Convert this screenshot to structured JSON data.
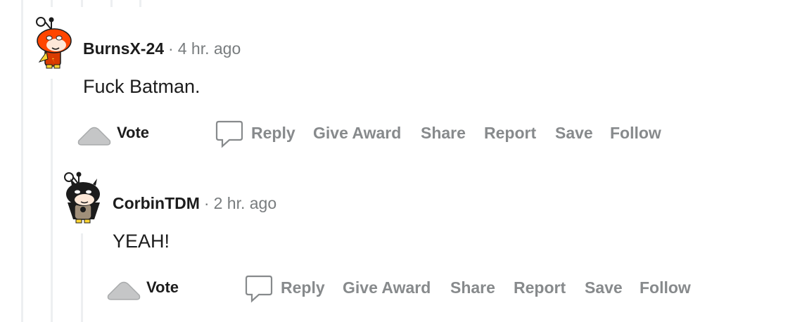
{
  "colors": {
    "thread_line": "#edeff1",
    "meta_gray": "#787c7e",
    "action_gray": "#878a8c",
    "text": "#1c1c1c"
  },
  "comments": [
    {
      "username": "BurnsX-24",
      "separator": "·",
      "time": "4 hr. ago",
      "body": "Fuck Batman.",
      "avatar_icon": "snoo-flash-avatar-icon",
      "actions": {
        "vote": "Vote",
        "reply": "Reply",
        "give_award": "Give Award",
        "share": "Share",
        "report": "Report",
        "save": "Save",
        "follow": "Follow"
      }
    },
    {
      "username": "CorbinTDM",
      "separator": "·",
      "time": "2 hr. ago",
      "body": "YEAH!",
      "avatar_icon": "snoo-batman-avatar-icon",
      "actions": {
        "vote": "Vote",
        "reply": "Reply",
        "give_award": "Give Award",
        "share": "Share",
        "report": "Report",
        "save": "Save",
        "follow": "Follow"
      }
    }
  ]
}
